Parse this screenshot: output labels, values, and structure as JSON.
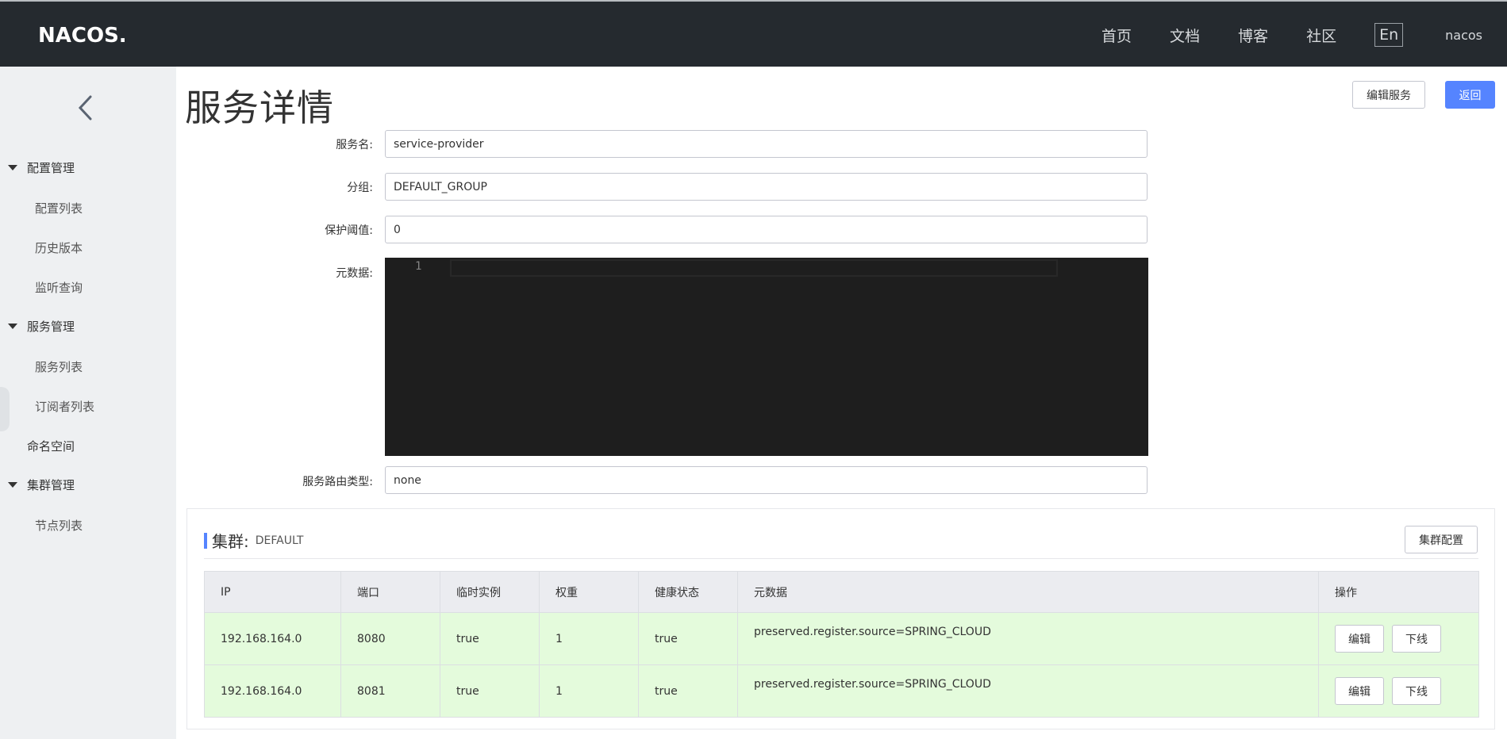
{
  "header": {
    "logo_text": "NACOS.",
    "nav": [
      "首页",
      "文档",
      "博客",
      "社区"
    ],
    "lang": "En",
    "user": "nacos"
  },
  "sidebar": {
    "groups": [
      {
        "label": "配置管理",
        "items": [
          "配置列表",
          "历史版本",
          "监听查询"
        ]
      },
      {
        "label": "服务管理",
        "items": [
          "服务列表",
          "订阅者列表"
        ]
      }
    ],
    "namespace": "命名空间",
    "cluster_group": {
      "label": "集群管理",
      "items": [
        "节点列表"
      ]
    }
  },
  "main": {
    "title": "服务详情",
    "edit_service": "编辑服务",
    "back": "返回"
  },
  "form": {
    "service_name": {
      "label": "服务名:",
      "value": "service-provider"
    },
    "group": {
      "label": "分组:",
      "value": "DEFAULT_GROUP"
    },
    "threshold": {
      "label": "保护阈值:",
      "value": "0"
    },
    "metadata": {
      "label": "元数据:",
      "line_no": "1"
    },
    "selector": {
      "label": "服务路由类型:",
      "value": "none"
    }
  },
  "cluster": {
    "title": "集群:",
    "name": "DEFAULT",
    "config_button": "集群配置",
    "columns": [
      "IP",
      "端口",
      "临时实例",
      "权重",
      "健康状态",
      "元数据",
      "操作"
    ],
    "rows": [
      {
        "ip": "192.168.164.0",
        "port": "8080",
        "ephemeral": "true",
        "weight": "1",
        "healthy": "true",
        "metadata": "preserved.register.source=SPRING_CLOUD"
      },
      {
        "ip": "192.168.164.0",
        "port": "8081",
        "ephemeral": "true",
        "weight": "1",
        "healthy": "true",
        "metadata": "preserved.register.source=SPRING_CLOUD"
      }
    ],
    "edit_label": "编辑",
    "offline_label": "下线"
  }
}
